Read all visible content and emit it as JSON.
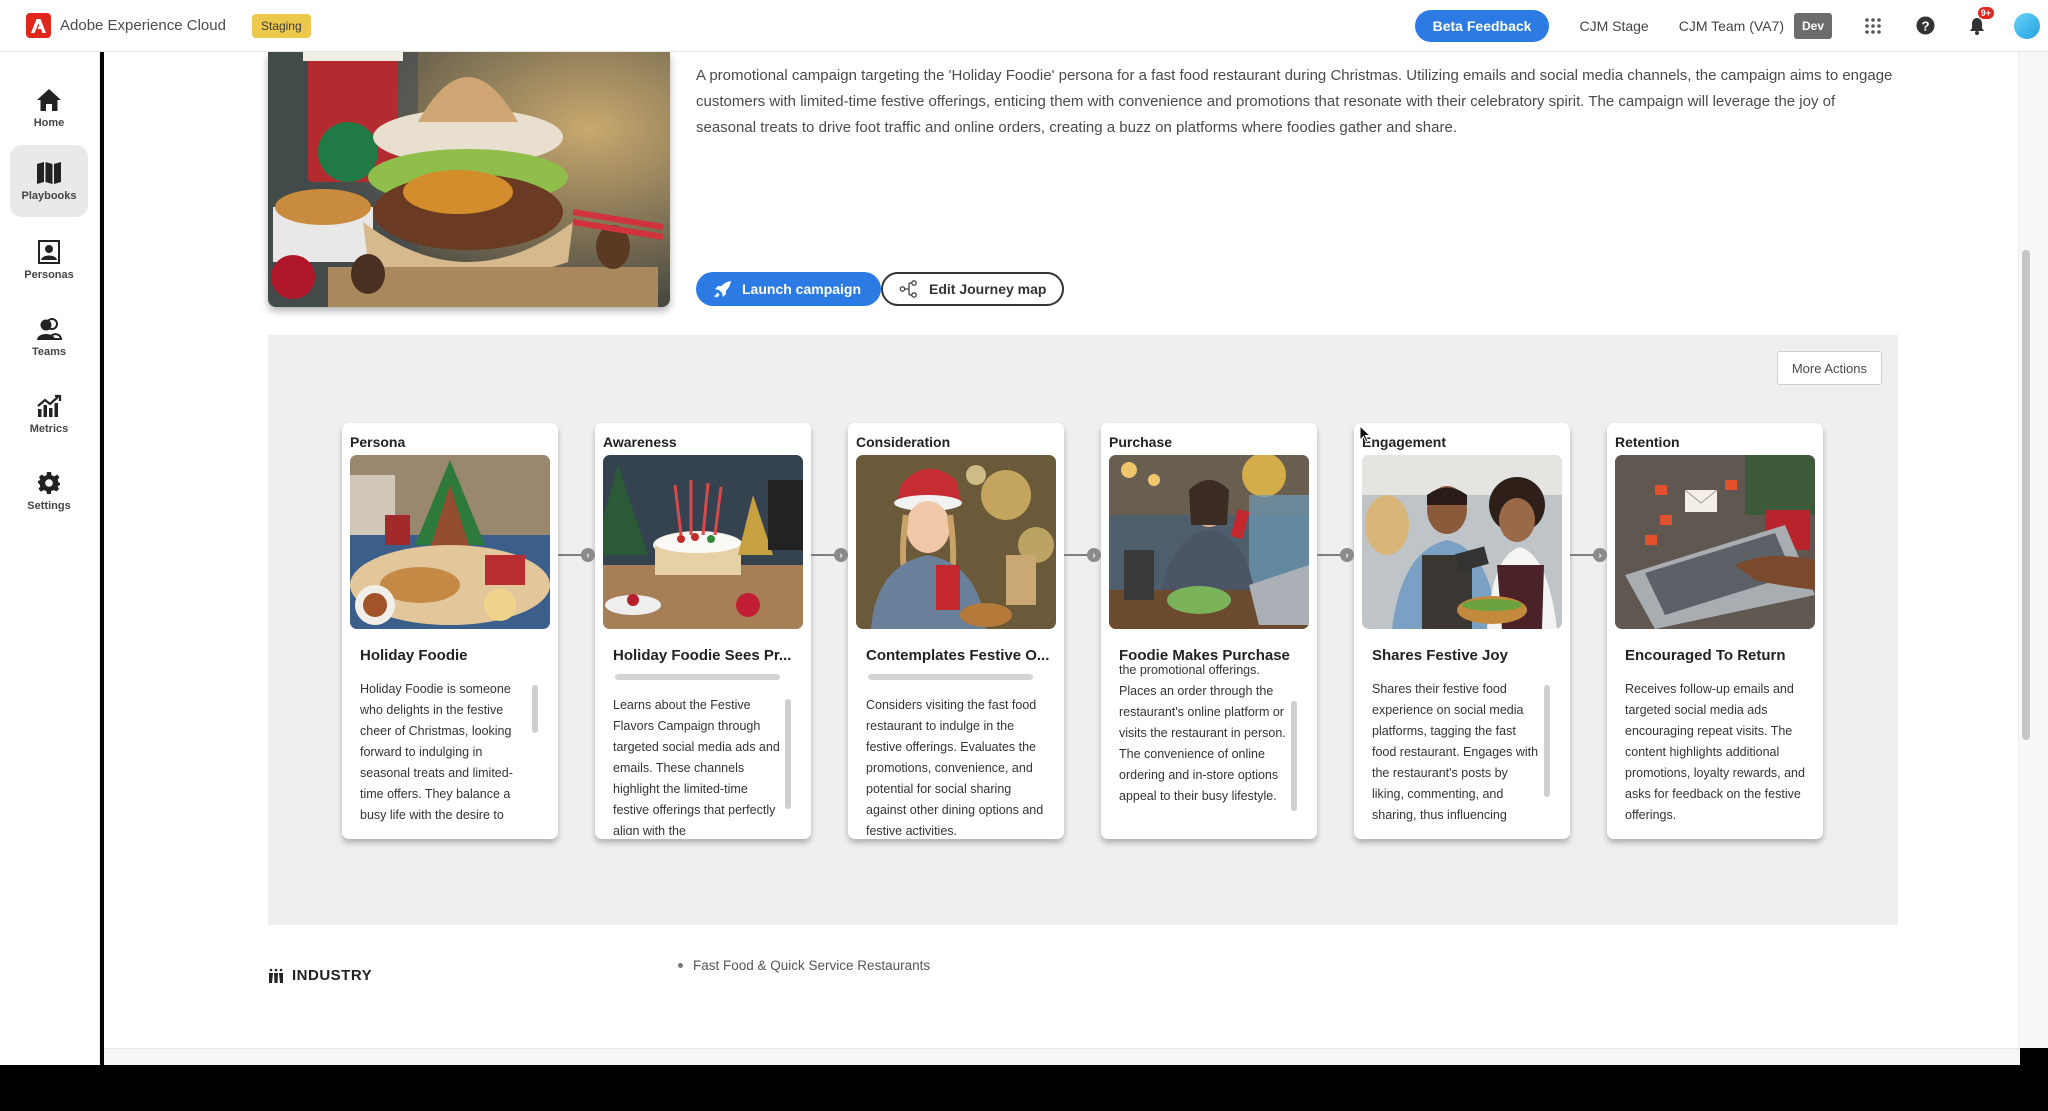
{
  "topbar": {
    "app_name": "Adobe Experience Cloud",
    "environment_badge": "Staging",
    "beta_feedback_label": "Beta Feedback",
    "org_link": "CJM Stage",
    "team_link": "CJM Team (VA7)",
    "team_env_badge": "Dev",
    "notification_count": "9+",
    "icons": [
      "adobe-logo-icon",
      "apps-grid-icon",
      "help-icon",
      "bell-icon",
      "user-avatar"
    ]
  },
  "sidebar": {
    "items": [
      {
        "label": "Home",
        "icon": "home-icon",
        "active": false
      },
      {
        "label": "Playbooks",
        "icon": "map-icon",
        "active": true
      },
      {
        "label": "Personas",
        "icon": "persona-icon",
        "active": false
      },
      {
        "label": "Teams",
        "icon": "teams-icon",
        "active": false
      },
      {
        "label": "Metrics",
        "icon": "metrics-icon",
        "active": false
      },
      {
        "label": "Settings",
        "icon": "gear-icon",
        "active": false
      }
    ]
  },
  "campaign": {
    "description": "A promotional campaign targeting the 'Holiday Foodie' persona for a fast food restaurant during Christmas. Utilizing emails and social media channels, the campaign aims to engage customers with limited-time festive offerings, enticing them with convenience and promotions that resonate with their celebratory spirit. The campaign will leverage the joy of seasonal treats to drive foot traffic and online orders, creating a buzz on platforms where foodies gather and share.",
    "launch_label": "Launch campaign",
    "edit_journey_label": "Edit Journey map"
  },
  "journey": {
    "more_actions_label": "More Actions",
    "stages": [
      {
        "stage": "Persona",
        "title": "Holiday Foodie",
        "text": "Holiday Foodie is someone who delights in the festive cheer of Christmas, looking forward to indulging in seasonal treats and limited-time offers. They balance a busy life with the desire to"
      },
      {
        "stage": "Awareness",
        "title": "Holiday Foodie Sees Pr...",
        "text": "Learns about the Festive Flavors Campaign through targeted social media ads and emails. These channels highlight the limited-time festive offerings that perfectly align with the"
      },
      {
        "stage": "Consideration",
        "title": "Contemplates Festive O...",
        "text": "Considers visiting the fast food restaurant to indulge in the festive offerings. Evaluates the promotions, convenience, and potential for social sharing against other dining options and festive activities."
      },
      {
        "stage": "Purchase",
        "title": "Foodie Makes Purchase",
        "text": "the promotional offerings. Places an order through the restaurant's online platform or visits the restaurant in person. The convenience of online ordering and in-store options appeal to their busy lifestyle."
      },
      {
        "stage": "Engagement",
        "title": "Shares Festive Joy",
        "text": "Shares their festive food experience on social media platforms, tagging the fast food restaurant. Engages with the restaurant's posts by liking, commenting, and sharing, thus influencing"
      },
      {
        "stage": "Retention",
        "title": "Encouraged To Return",
        "text": "Receives follow-up emails and targeted social media ads encouraging repeat visits. The content highlights additional promotions, loyalty rewards, and asks for feedback on the festive offerings."
      }
    ]
  },
  "industry": {
    "label": "INDUSTRY",
    "items": [
      "Fast Food & Quick Service Restaurants"
    ]
  },
  "colors": {
    "accent": "#2c7be5",
    "brand_red": "#e0261d",
    "staging_badge": "#ecc94b",
    "dev_badge": "#6c6c6c"
  }
}
